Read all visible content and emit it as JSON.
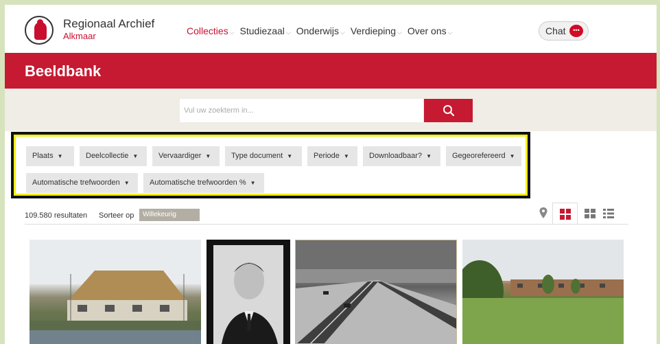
{
  "header": {
    "logo_title": "Regionaal Archief",
    "logo_subtitle": "Alkmaar",
    "nav": [
      {
        "label": "Collecties",
        "active": true
      },
      {
        "label": "Studiezaal",
        "active": false
      },
      {
        "label": "Onderwijs",
        "active": false
      },
      {
        "label": "Verdieping",
        "active": false
      },
      {
        "label": "Over ons",
        "active": false
      }
    ],
    "chat_label": "Chat"
  },
  "banner": {
    "title": "Beeldbank",
    "color": "#c51a31"
  },
  "search": {
    "placeholder": "Vul uw zoekterm in...",
    "icon": "search-icon"
  },
  "filters": [
    {
      "label": "Plaats"
    },
    {
      "label": "Deelcollectie"
    },
    {
      "label": "Vervaardiger"
    },
    {
      "label": "Type document"
    },
    {
      "label": "Periode"
    },
    {
      "label": "Downloadbaar?"
    },
    {
      "label": "Gegeorefereerd"
    },
    {
      "label": "Automatische trefwoorden"
    },
    {
      "label": "Automatische trefwoorden %"
    }
  ],
  "results": {
    "count_text": "109.580 resultaten",
    "sort_label": "Sorteer op",
    "sort_value": "Willekeurig"
  },
  "view_icons": [
    "map-pin-icon",
    "grid-large-icon",
    "grid-small-icon",
    "list-icon"
  ],
  "photos": [
    {
      "name": "photo-house-construction"
    },
    {
      "name": "photo-portrait-man"
    },
    {
      "name": "photo-highway"
    },
    {
      "name": "photo-field-houses"
    }
  ],
  "colors": {
    "accent": "#c51a31",
    "highlight": "#f2ee16",
    "background": "#d6e3bd"
  }
}
